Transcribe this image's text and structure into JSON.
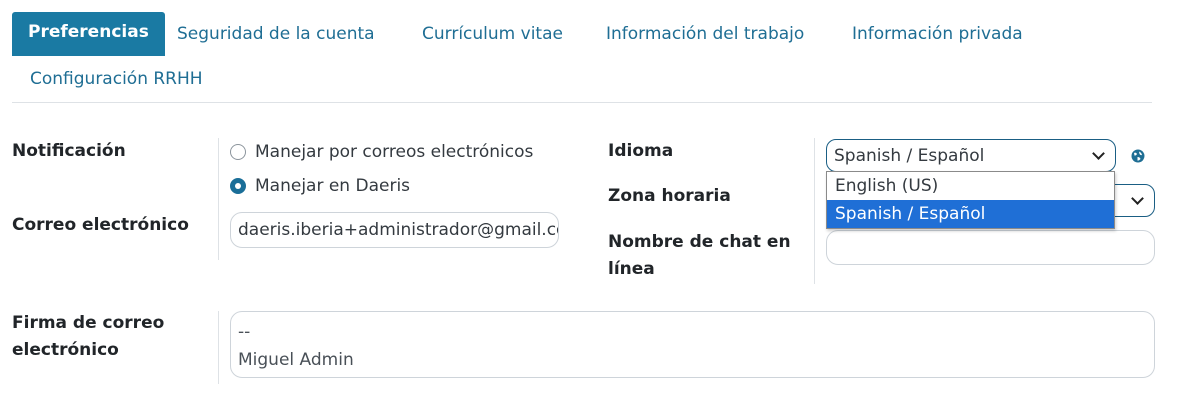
{
  "tabs": [
    {
      "label": "Preferencias",
      "active": true
    },
    {
      "label": "Seguridad de la cuenta"
    },
    {
      "label": "Currículum vitae"
    },
    {
      "label": "Información del trabajo"
    },
    {
      "label": "Información privada"
    },
    {
      "label": "Configuración RRHH"
    }
  ],
  "notification": {
    "label": "Notificación",
    "options": [
      "Manejar por correos electrónicos",
      "Manejar en Daeris"
    ],
    "selected": "Manejar en Daeris"
  },
  "email": {
    "label": "Correo electrónico",
    "value": "daeris.iberia+administrador@gmail.com"
  },
  "language": {
    "label": "Idioma",
    "selected": "Spanish / Español",
    "options": [
      "English (US)",
      "Spanish / Español"
    ],
    "icon": "globe-icon"
  },
  "timezone": {
    "label": "Zona horaria"
  },
  "chat_name": {
    "label_line1": "Nombre de chat en",
    "label_line2": "línea",
    "value": ""
  },
  "signature": {
    "label_line1": "Firma de correo",
    "label_line2": "electrónico",
    "lines": [
      "--",
      "Miguel Admin"
    ]
  },
  "colors": {
    "accent": "#1a7aa3",
    "link": "#1f6e94",
    "dropdown_highlight": "#1f6fd6"
  }
}
